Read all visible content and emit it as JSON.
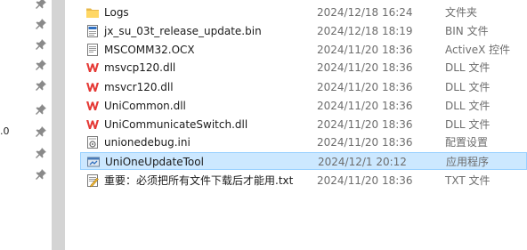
{
  "sidebar": {
    "partial_label": ".0",
    "pin_icons": [
      "pin-icon",
      "pin-icon",
      "pin-icon",
      "pin-icon",
      "pin-icon",
      "pin-icon",
      "pin-icon",
      "pin-icon",
      "pin-icon"
    ]
  },
  "files": [
    {
      "name": "Logs",
      "modified": "2024/12/18 16:24",
      "type": "文件夹",
      "icon": "folder-icon"
    },
    {
      "name": "jx_su_03t_release_update.bin",
      "modified": "2024/12/18 18:19",
      "type": "BIN 文件",
      "icon": "bin-file-icon"
    },
    {
      "name": "MSCOMM32.OCX",
      "modified": "2024/11/20 18:36",
      "type": "ActiveX 控件",
      "icon": "ocx-file-icon"
    },
    {
      "name": "msvcp120.dll",
      "modified": "2024/11/20 18:36",
      "type": "DLL 文件",
      "icon": "wps-dll-icon"
    },
    {
      "name": "msvcr120.dll",
      "modified": "2024/11/20 18:36",
      "type": "DLL 文件",
      "icon": "wps-dll-icon"
    },
    {
      "name": "UniCommon.dll",
      "modified": "2024/11/20 18:36",
      "type": "DLL 文件",
      "icon": "wps-dll-icon"
    },
    {
      "name": "UniCommunicateSwitch.dll",
      "modified": "2024/11/20 18:36",
      "type": "DLL 文件",
      "icon": "wps-dll-icon"
    },
    {
      "name": "unionedebug.ini",
      "modified": "2024/11/20 18:36",
      "type": "配置设置",
      "icon": "ini-file-icon"
    },
    {
      "name": "UniOneUpdateTool",
      "modified": "2024/12/1 20:12",
      "type": "应用程序",
      "icon": "app-icon",
      "selected": true
    },
    {
      "name": "重要：必须把所有文件下载后才能用.txt",
      "modified": "2024/11/20 18:36",
      "type": "TXT 文件",
      "icon": "txt-file-icon"
    }
  ]
}
